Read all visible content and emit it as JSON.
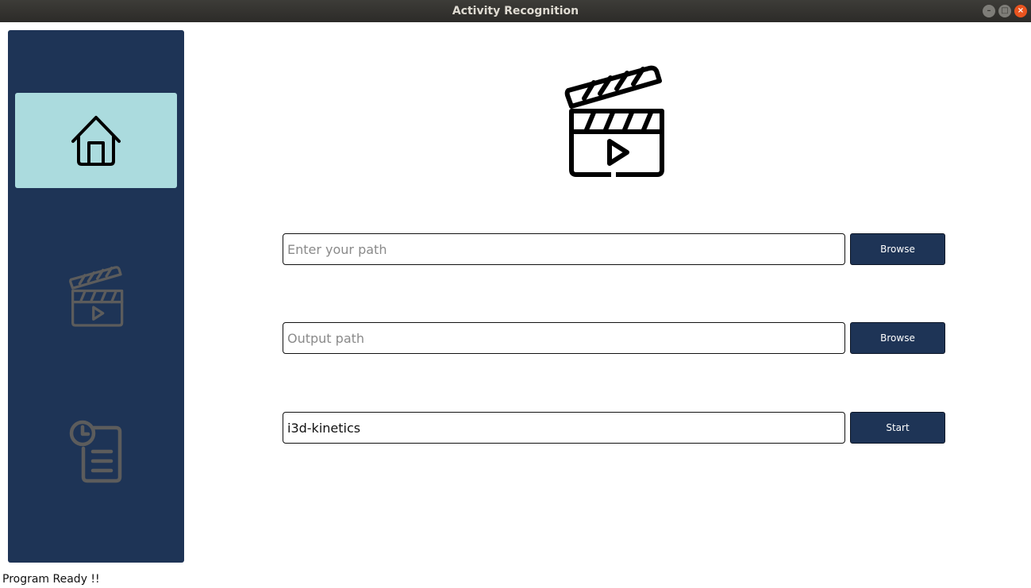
{
  "window": {
    "title": "Activity Recognition"
  },
  "sidebar": {
    "items": [
      {
        "id": "home",
        "icon": "home-icon",
        "active": true
      },
      {
        "id": "video",
        "icon": "clapperboard-icon",
        "active": false
      },
      {
        "id": "history",
        "icon": "history-report-icon",
        "active": false
      }
    ]
  },
  "main": {
    "hero_icon": "clapperboard-play-icon",
    "input_path": {
      "value": "",
      "placeholder": "Enter your path",
      "button_label": "Browse"
    },
    "output_path": {
      "value": "",
      "placeholder": "Output path",
      "button_label": "Browse"
    },
    "model": {
      "value": "i3d-kinetics",
      "button_label": "Start"
    }
  },
  "status": {
    "text": "Program Ready !!"
  },
  "colors": {
    "sidebar_bg": "#1e3456",
    "active_nav_bg": "#abdbde",
    "button_bg": "#1e3456",
    "inactive_icon": "#5c5c5c"
  }
}
